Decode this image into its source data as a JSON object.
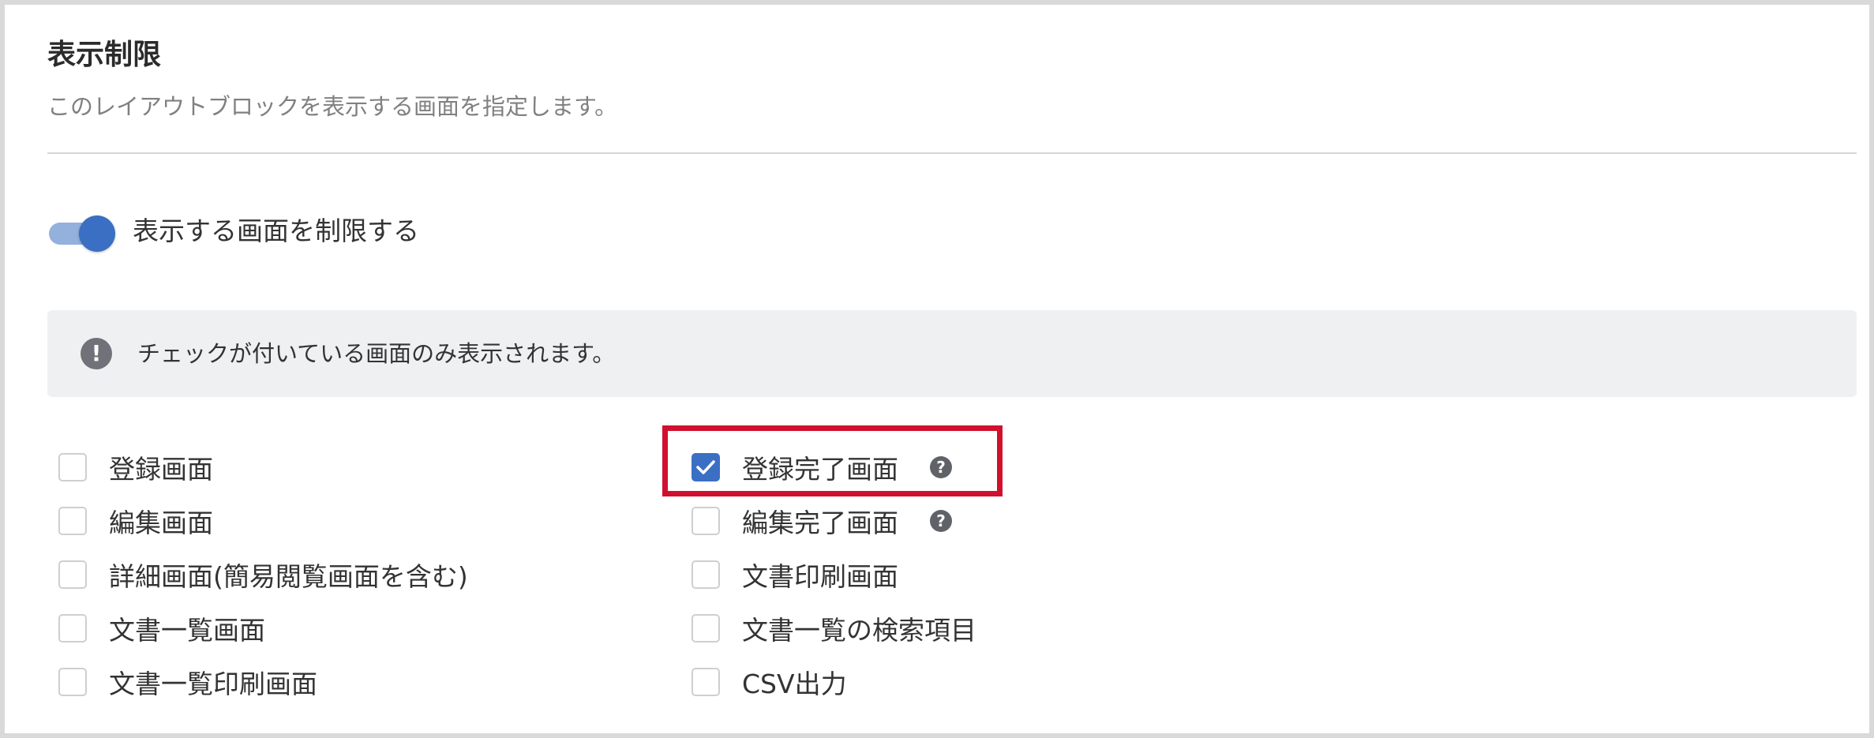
{
  "section": {
    "title": "表示制限",
    "description": "このレイアウトブロックを表示する画面を指定します。"
  },
  "toggle": {
    "label": "表示する画面を制限する",
    "on": true
  },
  "info": {
    "icon": "exclamation-circle-icon",
    "text": "チェックが付いている画面のみ表示されます。"
  },
  "checkboxes": {
    "left": [
      {
        "label": "登録画面",
        "checked": false
      },
      {
        "label": "編集画面",
        "checked": false
      },
      {
        "label": "詳細画面(簡易閲覧画面を含む)",
        "checked": false
      },
      {
        "label": "文書一覧画面",
        "checked": false
      },
      {
        "label": "文書一覧印刷画面",
        "checked": false
      }
    ],
    "right": [
      {
        "label": "登録完了画面",
        "checked": true,
        "help": "question-circle-icon"
      },
      {
        "label": "編集完了画面",
        "checked": false,
        "help": "question-circle-icon"
      },
      {
        "label": "文書印刷画面",
        "checked": false
      },
      {
        "label": "文書一覧の検索項目",
        "checked": false
      },
      {
        "label": "CSV出力",
        "checked": false
      }
    ]
  },
  "colors": {
    "accent": "#3b6fc4",
    "toggle_track": "#93b1dc",
    "highlight": "#d0102e",
    "info_bg": "#eff0f2"
  }
}
